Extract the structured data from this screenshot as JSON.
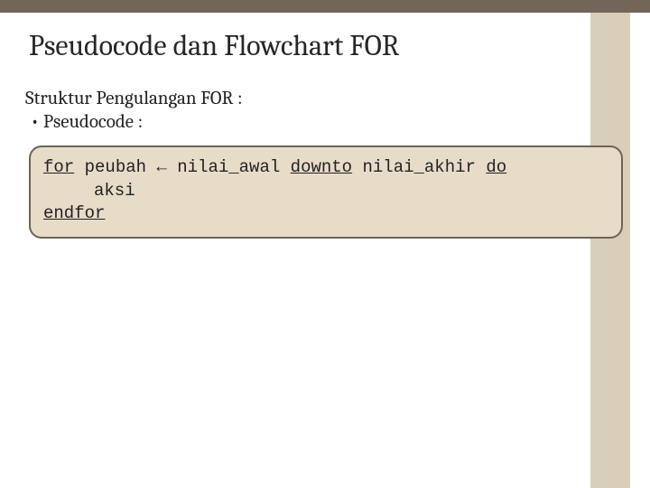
{
  "title": "Pseudocode dan Flowchart FOR",
  "subtitle": "Struktur Pengulangan FOR :",
  "bullet": "• Pseudocode :",
  "code": {
    "kw_for": "for",
    "var": " peubah ",
    "arrow": "←",
    "nilai_awal": " nilai_awal ",
    "kw_downto": "downto",
    "nilai_akhir": " nilai_akhir ",
    "kw_do": "do",
    "aksi": "aksi",
    "kw_endfor": "endfor"
  }
}
